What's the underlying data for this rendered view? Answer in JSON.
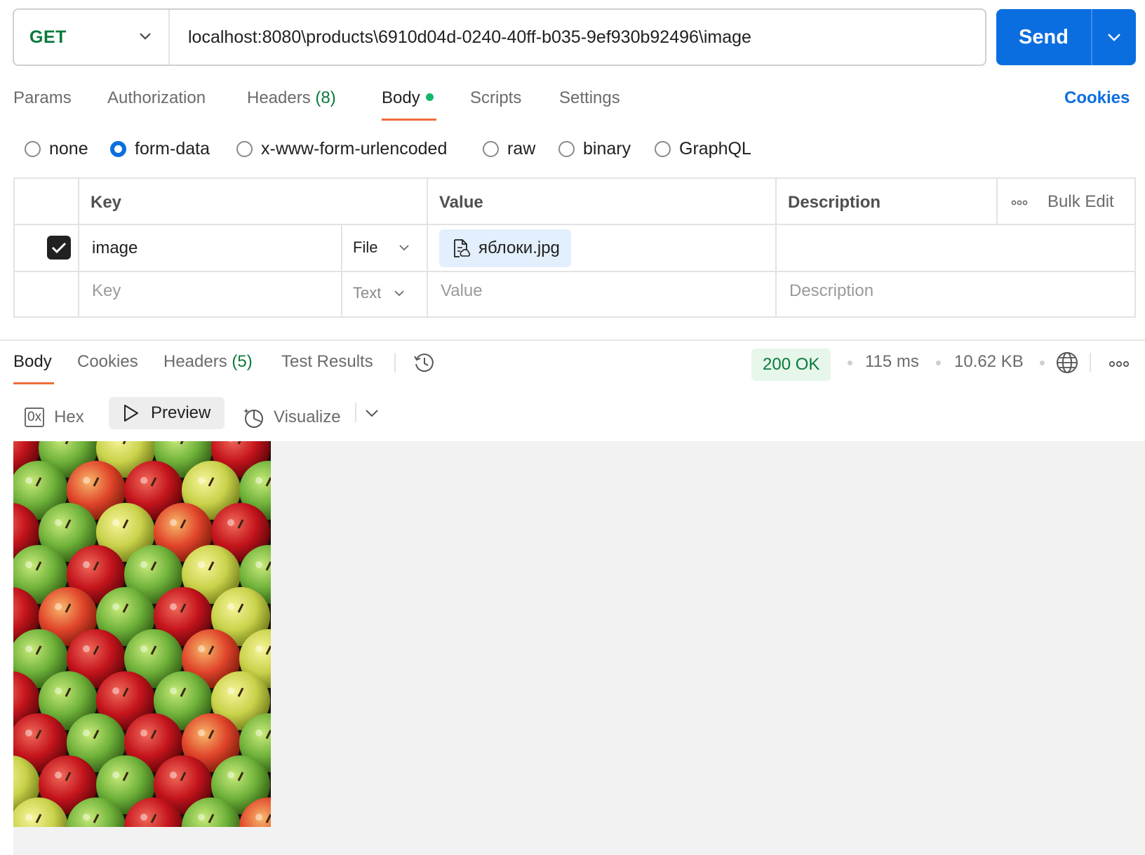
{
  "request": {
    "method": "GET",
    "url": "localhost:8080\\products\\6910d04d-0240-40ff-b035-9ef930b92496\\image",
    "send_label": "Send"
  },
  "request_tabs": {
    "params": "Params",
    "authorization": "Authorization",
    "headers": "Headers",
    "headers_count": "(8)",
    "body": "Body",
    "scripts": "Scripts",
    "settings": "Settings",
    "cookies": "Cookies"
  },
  "body_types": {
    "selected": "form-data",
    "options": [
      "none",
      "form-data",
      "x-www-form-urlencoded",
      "raw",
      "binary",
      "GraphQL"
    ]
  },
  "form_table": {
    "headers": {
      "key": "Key",
      "value": "Value",
      "description": "Description",
      "bulk_edit": "Bulk Edit"
    },
    "rows": [
      {
        "checked": true,
        "key": "image",
        "type": "File",
        "value": "яблоки.jpg",
        "description": ""
      }
    ],
    "placeholder_row": {
      "key": "Key",
      "type": "Text",
      "value": "Value",
      "description": "Description"
    }
  },
  "response": {
    "tabs": {
      "body": "Body",
      "cookies": "Cookies",
      "headers": "Headers",
      "headers_count": "(5)",
      "test_results": "Test Results"
    },
    "status": "200 OK",
    "time": "115 ms",
    "size": "10.62 KB",
    "view_modes": {
      "hex": "Hex",
      "preview": "Preview",
      "visualize": "Visualize",
      "active": "Preview"
    },
    "hex_icon_text": "0x"
  },
  "colors": {
    "primary": "#0b6ee0",
    "method_get": "#0a7a3b",
    "status_ok_bg": "#e6f6ea",
    "active_tab_underline": "#ef6c3a",
    "body_dot": "#12b76a"
  }
}
